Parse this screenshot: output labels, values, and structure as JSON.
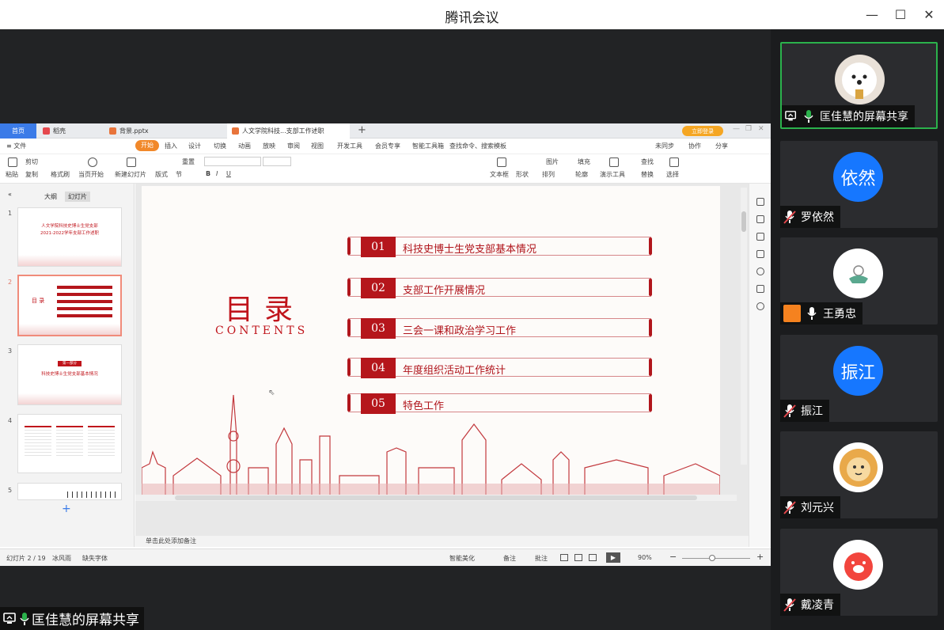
{
  "app": {
    "title": "腾讯会议"
  },
  "window_controls": {
    "minimize": "—",
    "maximize": "☐",
    "close": "✕"
  },
  "wps": {
    "tabs": [
      "首页",
      "稻壳",
      "背景.pptx",
      "人文学院科技...支部工作述职"
    ],
    "tab_new": "+",
    "login_label": "立即登录",
    "menu": [
      "≡ 文件",
      "开始",
      "插入",
      "设计",
      "切换",
      "动画",
      "放映",
      "审阅",
      "视图",
      "开发工具",
      "会员专享",
      "智能工具箱",
      "查找命令、搜索模板",
      "未同步",
      "协作",
      "分享"
    ],
    "ribbon_labels": [
      "粘贴",
      "剪切",
      "复制",
      "格式刷",
      "当页开始",
      "新建幻灯片",
      "版式",
      "节",
      "重置",
      "文本框",
      "形状",
      "排列",
      "图片",
      "填充",
      "轮廓",
      "演示工具",
      "查找",
      "替换",
      "选择"
    ],
    "panel_tabs": [
      "大纲",
      "幻灯片"
    ],
    "slide_numbers": [
      "1",
      "2",
      "3",
      "4",
      "5"
    ],
    "thumb1": {
      "line1": "人文学院科技史博士生党支部",
      "line2": "2021-2022学年支部工作述职"
    },
    "thumb3": {
      "badge": "第一部分",
      "line1": "科技史博士生党支部基本情况"
    },
    "notes_placeholder": "单击此处添加备注",
    "status": {
      "slide_info": "幻灯片 2 / 19",
      "theme": "冰风雨",
      "missing_font": "缺失字体",
      "beautify": "智能美化",
      "notes": "备注",
      "comments": "批注",
      "zoom": "90%"
    }
  },
  "slide": {
    "title_cn": "目录",
    "title_en": "CONTENTS",
    "items": [
      {
        "num": "01",
        "text": "科技史博士生党支部基本情况"
      },
      {
        "num": "02",
        "text": "支部工作开展情况"
      },
      {
        "num": "03",
        "text": "三会一课和政治学习工作"
      },
      {
        "num": "04",
        "text": "年度组织活动工作统计"
      },
      {
        "num": "05",
        "text": "特色工作"
      }
    ]
  },
  "share_indicator": "匡佳慧的屏幕共享",
  "participants": [
    {
      "name": "匡佳慧的屏幕共享",
      "avatar_text": "",
      "muted": false,
      "speaking": true,
      "avatar_color": "#e9e1d8"
    },
    {
      "name": "罗依然",
      "avatar_text": "依然",
      "muted": true,
      "speaking": false,
      "avatar_color": "#1677ff"
    },
    {
      "name": "王勇忠",
      "avatar_text": "",
      "muted": false,
      "speaking": false,
      "avatar_color": "#ffffff"
    },
    {
      "name": "振江",
      "avatar_text": "振江",
      "muted": true,
      "speaking": false,
      "avatar_color": "#1677ff"
    },
    {
      "name": "刘元兴",
      "avatar_text": "",
      "muted": true,
      "speaking": false,
      "avatar_color": "#ffffff"
    },
    {
      "name": "戴凌青",
      "avatar_text": "",
      "muted": true,
      "speaking": false,
      "avatar_color": "#ffffff"
    }
  ],
  "colors": {
    "accent_red": "#b5161c",
    "meeting_green": "#2bb24c",
    "meeting_blue": "#1677ff",
    "wps_orange": "#f1882a"
  }
}
